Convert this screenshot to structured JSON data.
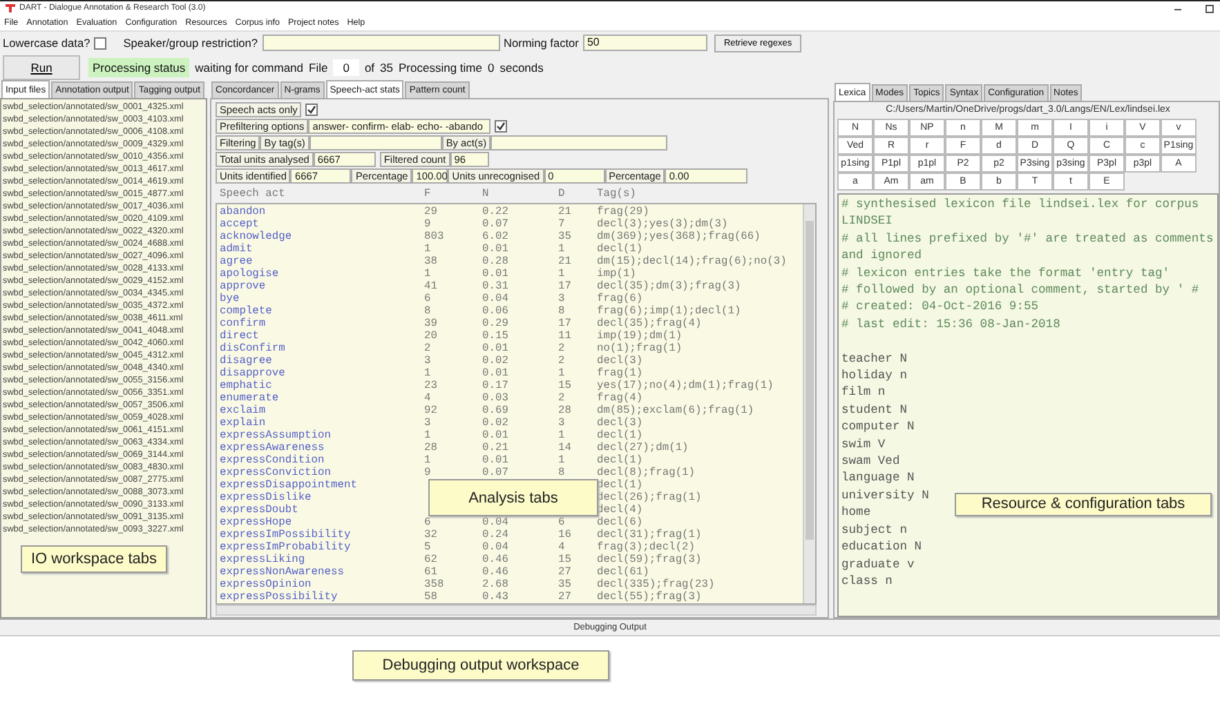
{
  "window": {
    "title": "DART - Dialogue Annotation & Research Tool (3.0)"
  },
  "menu": [
    "File",
    "Annotation",
    "Evaluation",
    "Configuration",
    "Resources",
    "Corpus info",
    "Project notes",
    "Help"
  ],
  "options": {
    "lowercase_label": "Lowercase data?",
    "lowercase_checked": false,
    "speaker_label": "Speaker/group restriction?",
    "norming_label": "Norming factor",
    "norming_value": "50",
    "retrieve_button": "Retrieve regexes"
  },
  "run_bar": {
    "run_button": "Run",
    "status_label": "Processing status",
    "status_text": "waiting for command",
    "file_label": "File",
    "file_value": "0",
    "of_label": "of",
    "total_value": "35",
    "time_label": "Processing time",
    "time_value": "0",
    "seconds_label": "seconds"
  },
  "io_tabs": [
    {
      "label": "Input files",
      "selected": true
    },
    {
      "label": "Annotation output",
      "selected": false
    },
    {
      "label": "Tagging output",
      "selected": false
    }
  ],
  "files": [
    "swbd_selection/annotated/sw_0001_4325.xml",
    "swbd_selection/annotated/sw_0003_4103.xml",
    "swbd_selection/annotated/sw_0006_4108.xml",
    "swbd_selection/annotated/sw_0009_4329.xml",
    "swbd_selection/annotated/sw_0010_4356.xml",
    "swbd_selection/annotated/sw_0013_4617.xml",
    "swbd_selection/annotated/sw_0014_4619.xml",
    "swbd_selection/annotated/sw_0015_4877.xml",
    "swbd_selection/annotated/sw_0017_4036.xml",
    "swbd_selection/annotated/sw_0020_4109.xml",
    "swbd_selection/annotated/sw_0022_4320.xml",
    "swbd_selection/annotated/sw_0024_4688.xml",
    "swbd_selection/annotated/sw_0027_4096.xml",
    "swbd_selection/annotated/sw_0028_4133.xml",
    "swbd_selection/annotated/sw_0029_4152.xml",
    "swbd_selection/annotated/sw_0034_4345.xml",
    "swbd_selection/annotated/sw_0035_4372.xml",
    "swbd_selection/annotated/sw_0038_4611.xml",
    "swbd_selection/annotated/sw_0041_4048.xml",
    "swbd_selection/annotated/sw_0042_4060.xml",
    "swbd_selection/annotated/sw_0045_4312.xml",
    "swbd_selection/annotated/sw_0048_4340.xml",
    "swbd_selection/annotated/sw_0055_3156.xml",
    "swbd_selection/annotated/sw_0056_3351.xml",
    "swbd_selection/annotated/sw_0057_3506.xml",
    "swbd_selection/annotated/sw_0059_4028.xml",
    "swbd_selection/annotated/sw_0061_4151.xml",
    "swbd_selection/annotated/sw_0063_4334.xml",
    "swbd_selection/annotated/sw_0069_3144.xml",
    "swbd_selection/annotated/sw_0083_4830.xml",
    "swbd_selection/annotated/sw_0087_2775.xml",
    "swbd_selection/annotated/sw_0088_3073.xml",
    "swbd_selection/annotated/sw_0090_3133.xml",
    "swbd_selection/annotated/sw_0091_3135.xml",
    "swbd_selection/annotated/sw_0093_3227.xml"
  ],
  "analysis_tabs": [
    {
      "label": "Concordancer",
      "selected": false
    },
    {
      "label": "N-grams",
      "selected": false
    },
    {
      "label": "Speech-act stats",
      "selected": true
    },
    {
      "label": "Pattern count",
      "selected": false
    }
  ],
  "speech_act_stats": {
    "speech_acts_only": {
      "label": "Speech acts only",
      "checked": true
    },
    "prefiltering": {
      "label": "Prefiltering options",
      "value": "answer- confirm- elab- echo- -abando",
      "checked": true
    },
    "filtering_label": "Filtering",
    "by_tags_label": "By tag(s)",
    "by_acts_label": "By act(s)",
    "total_label": "Total units analysed",
    "total_value": "6667",
    "filtered_label": "Filtered count",
    "filtered_value": "96",
    "identified_label": "Units identified",
    "identified_value": "6667",
    "percentage_label": "Percentage",
    "percentage_value": "100.00",
    "unrecognised_label": "Units unrecognised",
    "unrecognised_value": "0",
    "percentage2_label": "Percentage",
    "percentage2_value": "0.00",
    "columns": [
      "Speech act",
      "F",
      "N",
      "D",
      "Tag(s)"
    ],
    "rows": [
      {
        "act": "abandon",
        "f": "29",
        "n": "0.22",
        "d": "21",
        "tags": "frag(29)"
      },
      {
        "act": "accept",
        "f": "9",
        "n": "0.07",
        "d": "7",
        "tags": "decl(3);yes(3);dm(3)"
      },
      {
        "act": "acknowledge",
        "f": "803",
        "n": "6.02",
        "d": "35",
        "tags": "dm(369);yes(368);frag(66)"
      },
      {
        "act": "admit",
        "f": "1",
        "n": "0.01",
        "d": "1",
        "tags": "decl(1)"
      },
      {
        "act": "agree",
        "f": "38",
        "n": "0.28",
        "d": "21",
        "tags": "dm(15);decl(14);frag(6);no(3)"
      },
      {
        "act": "apologise",
        "f": "1",
        "n": "0.01",
        "d": "1",
        "tags": "imp(1)"
      },
      {
        "act": "approve",
        "f": "41",
        "n": "0.31",
        "d": "17",
        "tags": "decl(35);dm(3);frag(3)"
      },
      {
        "act": "bye",
        "f": "6",
        "n": "0.04",
        "d": "3",
        "tags": "frag(6)"
      },
      {
        "act": "complete",
        "f": "8",
        "n": "0.06",
        "d": "8",
        "tags": "frag(6);imp(1);decl(1)"
      },
      {
        "act": "confirm",
        "f": "39",
        "n": "0.29",
        "d": "17",
        "tags": "decl(35);frag(4)"
      },
      {
        "act": "direct",
        "f": "20",
        "n": "0.15",
        "d": "11",
        "tags": "imp(19);dm(1)"
      },
      {
        "act": "disConfirm",
        "f": "2",
        "n": "0.01",
        "d": "2",
        "tags": "no(1);frag(1)"
      },
      {
        "act": "disagree",
        "f": "3",
        "n": "0.02",
        "d": "2",
        "tags": "decl(3)"
      },
      {
        "act": "disapprove",
        "f": "1",
        "n": "0.01",
        "d": "1",
        "tags": "frag(1)"
      },
      {
        "act": "emphatic",
        "f": "23",
        "n": "0.17",
        "d": "15",
        "tags": "yes(17);no(4);dm(1);frag(1)"
      },
      {
        "act": "enumerate",
        "f": "4",
        "n": "0.03",
        "d": "2",
        "tags": "frag(4)"
      },
      {
        "act": "exclaim",
        "f": "92",
        "n": "0.69",
        "d": "28",
        "tags": "dm(85);exclam(6);frag(1)"
      },
      {
        "act": "explain",
        "f": "3",
        "n": "0.02",
        "d": "3",
        "tags": "decl(3)"
      },
      {
        "act": "expressAssumption",
        "f": "1",
        "n": "0.01",
        "d": "1",
        "tags": "decl(1)"
      },
      {
        "act": "expressAwareness",
        "f": "28",
        "n": "0.21",
        "d": "14",
        "tags": "decl(27);dm(1)"
      },
      {
        "act": "expressCondition",
        "f": "1",
        "n": "0.01",
        "d": "1",
        "tags": "decl(1)"
      },
      {
        "act": "expressConviction",
        "f": "9",
        "n": "0.07",
        "d": "8",
        "tags": "decl(8);frag(1)"
      },
      {
        "act": "expressDisappointment",
        "tags": "decl(1)"
      },
      {
        "act": "expressDislike",
        "tags": "decl(26);frag(1)"
      },
      {
        "act": "expressDoubt",
        "tags": "decl(4)"
      },
      {
        "act": "expressHope",
        "f": "6",
        "n": "0.04",
        "d": "6",
        "tags": "decl(6)"
      },
      {
        "act": "expressImPossibility",
        "f": "32",
        "n": "0.24",
        "d": "16",
        "tags": "decl(31);frag(1)"
      },
      {
        "act": "expressImProbability",
        "f": "5",
        "n": "0.04",
        "d": "4",
        "tags": "frag(3);decl(2)"
      },
      {
        "act": "expressLiking",
        "f": "62",
        "n": "0.46",
        "d": "15",
        "tags": "decl(59);frag(3)"
      },
      {
        "act": "expressNonAwareness",
        "f": "61",
        "n": "0.46",
        "d": "27",
        "tags": "decl(61)"
      },
      {
        "act": "expressOpinion",
        "f": "358",
        "n": "2.68",
        "d": "35",
        "tags": "decl(335);frag(23)"
      },
      {
        "act": "expressPossibility",
        "f": "58",
        "n": "0.43",
        "d": "27",
        "tags": "decl(55);frag(3)"
      }
    ]
  },
  "resource_tabs": [
    {
      "label": "Lexica",
      "selected": true
    },
    {
      "label": "Modes",
      "selected": false
    },
    {
      "label": "Topics",
      "selected": false
    },
    {
      "label": "Syntax",
      "selected": false
    },
    {
      "label": "Configuration",
      "selected": false
    },
    {
      "label": "Notes",
      "selected": false
    }
  ],
  "lexicon": {
    "path": "C:/Users/Martin/OneDrive/progs/dart_3.0/Langs/EN/Lex/lindsei.lex",
    "tag_buttons": [
      "N",
      "Ns",
      "NP",
      "n",
      "M",
      "m",
      "I",
      "i",
      "V",
      "v",
      "Ved",
      "R",
      "r",
      "F",
      "d",
      "D",
      "Q",
      "C",
      "c",
      "P1sing",
      "p1sing",
      "P1pl",
      "p1pl",
      "P2",
      "p2",
      "P3sing",
      "p3sing",
      "P3pl",
      "p3pl",
      "A",
      "a",
      "Am",
      "am",
      "B",
      "b",
      "T",
      "t",
      "E"
    ],
    "lines": [
      {
        "kind": "comment",
        "text": "# synthesised lexicon file lindsei.lex for corpus LINDSEI"
      },
      {
        "kind": "comment",
        "text": "# all lines prefixed by '#' are treated as comments and ignored"
      },
      {
        "kind": "comment",
        "text": "# lexicon entries take the format 'entry tag'"
      },
      {
        "kind": "comment",
        "text": "# followed by an optional comment, started by ' #"
      },
      {
        "kind": "comment",
        "text": "# created: 04-Oct-2016 9:55"
      },
      {
        "kind": "comment",
        "text": "# last edit: 15:36 08-Jan-2018"
      },
      {
        "kind": "entry",
        "text": "teacher N"
      },
      {
        "kind": "entry",
        "text": "holiday n"
      },
      {
        "kind": "entry",
        "text": "film n"
      },
      {
        "kind": "entry",
        "text": "student N"
      },
      {
        "kind": "entry",
        "text": "computer N"
      },
      {
        "kind": "entry",
        "text": "swim V"
      },
      {
        "kind": "entry",
        "text": "swam Ved"
      },
      {
        "kind": "entry",
        "text": "language N"
      },
      {
        "kind": "entry",
        "text": "university N"
      },
      {
        "kind": "entry",
        "text": "home"
      },
      {
        "kind": "entry",
        "text": "subject n"
      },
      {
        "kind": "entry",
        "text": "education N"
      },
      {
        "kind": "entry",
        "text": "graduate v"
      },
      {
        "kind": "entry",
        "text": "class n"
      }
    ]
  },
  "debug": {
    "title": "Debugging Output"
  },
  "callouts": [
    {
      "kind": "io",
      "text": "IO workspace tabs"
    },
    {
      "kind": "analysis",
      "text": "Analysis tabs"
    },
    {
      "kind": "resource",
      "text": "Resource & configuration tabs"
    },
    {
      "kind": "debug",
      "text": "Debugging output workspace"
    }
  ]
}
